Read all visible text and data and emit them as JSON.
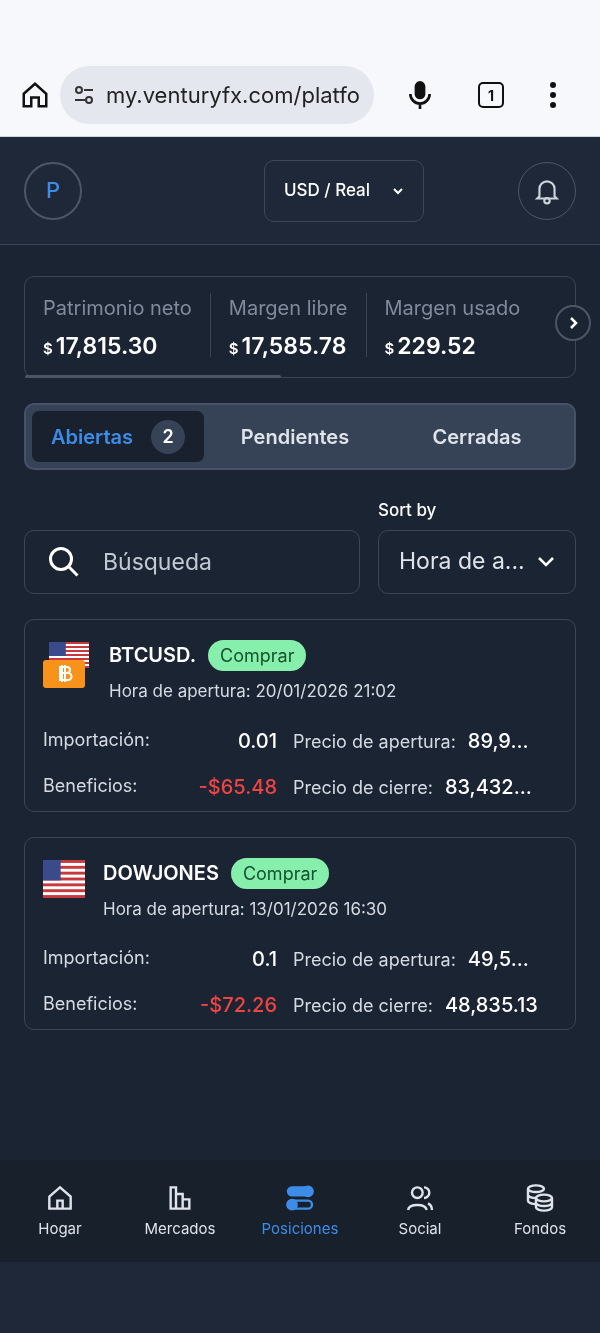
{
  "browser": {
    "url": "my.venturyfx.com/platfo",
    "tab_count": "1"
  },
  "header": {
    "avatar": "P",
    "account": "USD / Real"
  },
  "stats": [
    {
      "label": "Patrimonio neto",
      "currency": "$",
      "value": "17,815.30"
    },
    {
      "label": "Margen libre",
      "currency": "$",
      "value": "17,585.78"
    },
    {
      "label": "Margen usado",
      "currency": "$",
      "value": "229.52"
    }
  ],
  "tabs": [
    {
      "label": "Abiertas",
      "count": "2",
      "selected": true
    },
    {
      "label": "Pendientes",
      "selected": false
    },
    {
      "label": "Cerradas",
      "selected": false
    }
  ],
  "search": {
    "placeholder": "Búsqueda"
  },
  "sort": {
    "label": "Sort by",
    "value": "Hora de a..."
  },
  "positions": [
    {
      "kind": "crypto",
      "symbol": "BTCUSD.",
      "side": "Comprar",
      "opened": "Hora de apertura: 20/01/2026 21:02",
      "amount_label": "Importación:",
      "amount": "0.01",
      "profit_label": "Beneficios:",
      "profit": "-$65.48",
      "loss": true,
      "open_label": "Precio de apertura:",
      "open_price": "89,9...",
      "close_label": "Precio de cierre:",
      "close_price": "83,432..."
    },
    {
      "kind": "index",
      "symbol": "DOWJONES",
      "side": "Comprar",
      "opened": "Hora de apertura: 13/01/2026 16:30",
      "amount_label": "Importación:",
      "amount": "0.1",
      "profit_label": "Beneficios:",
      "profit": "-$72.26",
      "loss": true,
      "open_label": "Precio de apertura:",
      "open_price": "49,5...",
      "close_label": "Precio de cierre:",
      "close_price": "48,835.13"
    }
  ],
  "nav": [
    {
      "label": "Hogar",
      "kind": "home",
      "selected": false
    },
    {
      "label": "Mercados",
      "kind": "bars",
      "selected": false
    },
    {
      "label": "Posiciones",
      "kind": "toggles",
      "selected": true
    },
    {
      "label": "Social",
      "kind": "people",
      "selected": false
    },
    {
      "label": "Fondos",
      "kind": "coins",
      "selected": false
    }
  ]
}
